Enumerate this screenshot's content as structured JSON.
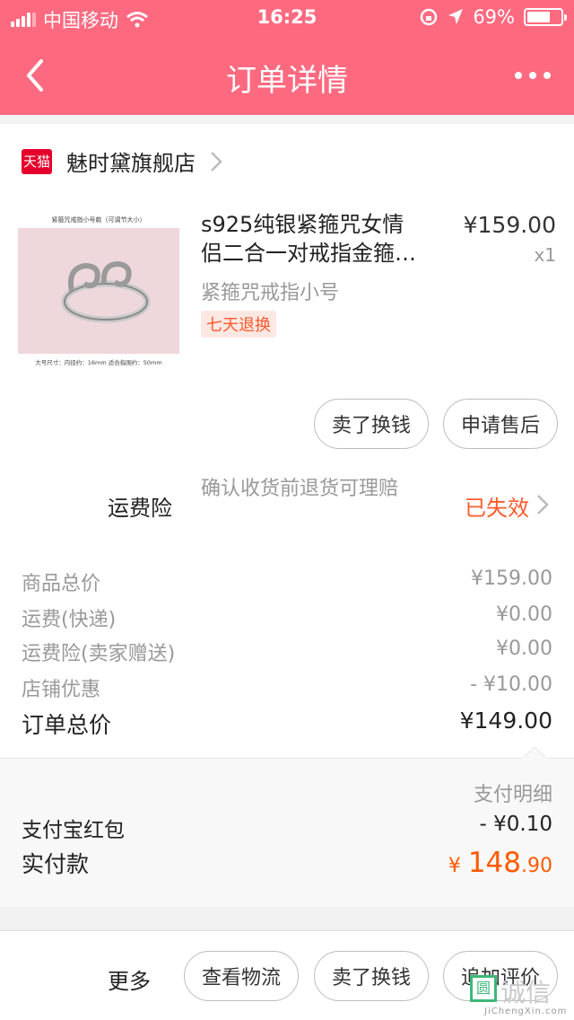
{
  "status_bar": {
    "carrier": "中国移动",
    "time": "16:25",
    "battery": "69%",
    "battery_level": 0.69
  },
  "nav": {
    "title": "订单详情"
  },
  "shop": {
    "badge": "天猫",
    "name": "魅时黛旗舰店"
  },
  "product": {
    "image_caption_top": "紧箍咒戒指小号款（可调节大小）",
    "image_caption_bottom": "大号尺寸：内径约：16mm   适合指围约：50mm",
    "title_line1": "s925纯银紧箍咒女情",
    "title_line2": "侣二合一对戒指金箍…",
    "price": "¥159.00",
    "qty": "x1",
    "spec": "紧箍咒戒指小号",
    "tag": "七天退换"
  },
  "item_actions": {
    "sell": "卖了换钱",
    "after_sale": "申请售后"
  },
  "insurance": {
    "label": "运费险",
    "desc": "确认收货前退货可理赔",
    "status": "已失效"
  },
  "fees": [
    {
      "label": "商品总价",
      "value": "¥159.00"
    },
    {
      "label": "运费(快递)",
      "value": "¥0.00"
    },
    {
      "label": "运费险(卖家赠送)",
      "value": "¥0.00"
    },
    {
      "label": "店铺优惠",
      "value": "- ¥10.00"
    }
  ],
  "total": {
    "label": "订单总价",
    "value": "¥149.00"
  },
  "payment": {
    "detail_link": "支付明细",
    "redpacket_label": "支付宝红包",
    "redpacket_value": "- ¥0.10",
    "paid_label": "实付款",
    "paid_currency": "¥",
    "paid_int": "148",
    "paid_dec": ".90"
  },
  "bottom_bar": {
    "more": "更多",
    "logistics": "查看物流",
    "sell": "卖了换钱",
    "review": "追加评价"
  },
  "watermark": {
    "logo": "圆",
    "text": "诚信",
    "url": "JiChengXin.com"
  },
  "colors": {
    "header": "#fd6a80",
    "accent": "#ff5a2c",
    "tmall": "#e4002b"
  }
}
